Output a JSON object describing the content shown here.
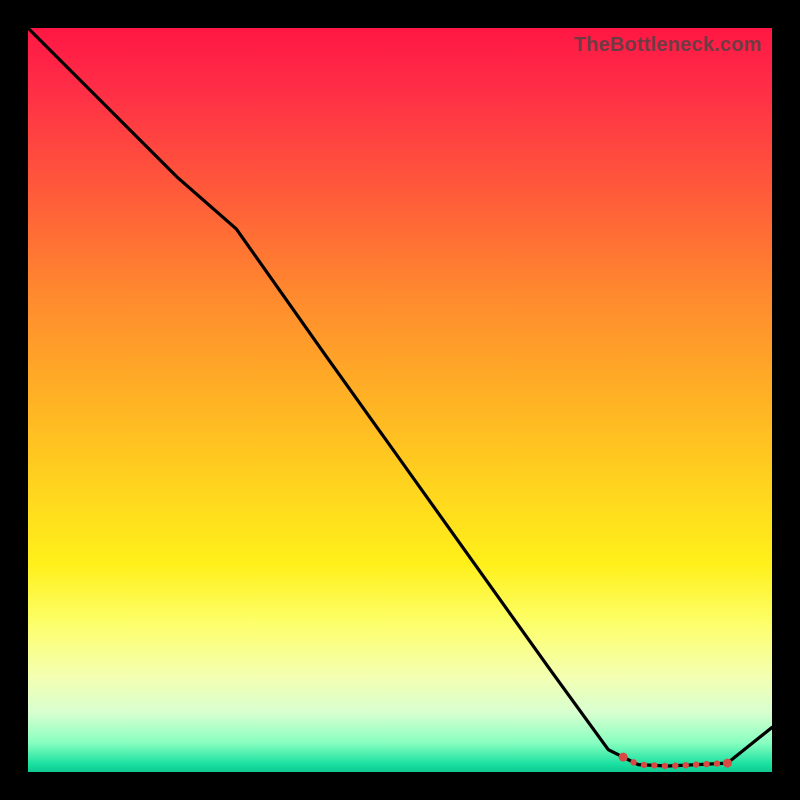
{
  "watermark": "TheBottleneck.com",
  "chart_data": {
    "type": "line",
    "title": "",
    "xlabel": "",
    "ylabel": "",
    "xlim": [
      0,
      100
    ],
    "ylim": [
      0,
      100
    ],
    "series": [
      {
        "name": "curve",
        "x": [
          0,
          10,
          20,
          28,
          40,
          50,
          60,
          70,
          78,
          82,
          86,
          90,
          94,
          100
        ],
        "y": [
          100,
          90,
          80,
          73,
          56,
          42,
          28,
          14,
          3,
          1,
          0.8,
          1,
          1.2,
          6
        ]
      }
    ],
    "optimal_band": {
      "x_start": 80,
      "x_end": 94,
      "color": "#d84a43"
    }
  }
}
